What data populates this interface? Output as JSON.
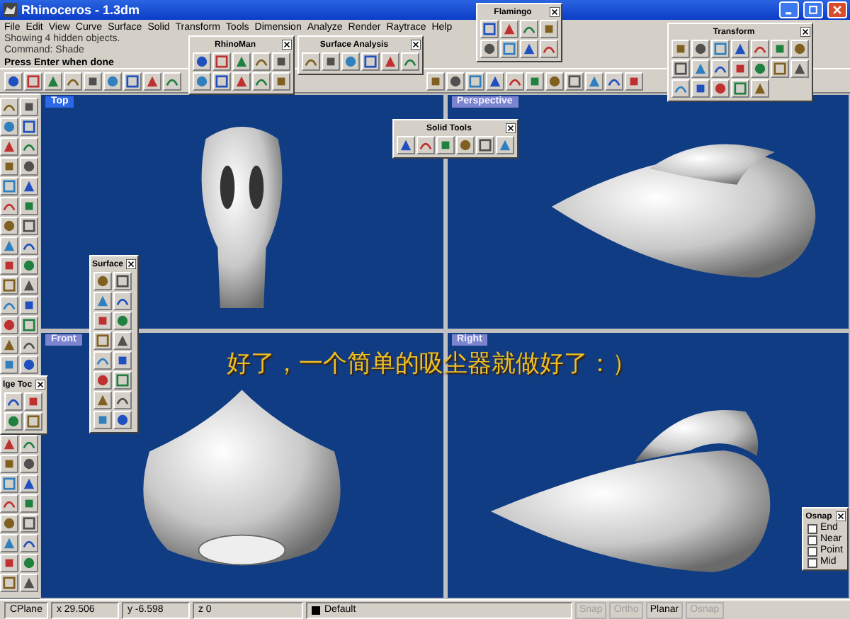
{
  "window": {
    "title": "Rhinoceros - 1.3dm"
  },
  "menu": [
    "File",
    "Edit",
    "View",
    "Curve",
    "Surface",
    "Solid",
    "Transform",
    "Tools",
    "Dimension",
    "Analyze",
    "Render",
    "Raytrace",
    "Help"
  ],
  "command": {
    "history": [
      "Showing 4 hidden objects.",
      "Command: Shade"
    ],
    "prompt": "Press Enter when done"
  },
  "viewports": [
    {
      "label": "Top",
      "active": true
    },
    {
      "label": "Perspective",
      "active": false
    },
    {
      "label": "Front",
      "active": false
    },
    {
      "label": "Right",
      "active": false
    }
  ],
  "caption": "好了，一个简单的吸尘器就做好了：）",
  "floating_toolbars": [
    {
      "title": "RhinoMan",
      "kind": "buttons"
    },
    {
      "title": "Surface Analysis",
      "kind": "buttons"
    },
    {
      "title": "Flamingo",
      "kind": "buttons"
    },
    {
      "title": "Transform",
      "kind": "buttons"
    },
    {
      "title": "Solid Tools",
      "kind": "buttons"
    },
    {
      "title": "Surface",
      "kind": "buttons"
    },
    {
      "title": "lge Toc",
      "kind": "buttons"
    },
    {
      "title": "Osnap",
      "kind": "checklist",
      "items": [
        {
          "label": "End",
          "checked": false
        },
        {
          "label": "Near",
          "checked": false
        },
        {
          "label": "Point",
          "checked": false
        },
        {
          "label": "Mid",
          "checked": false
        }
      ]
    }
  ],
  "status_bar": {
    "cplane": "CPlane",
    "x": "x 29.506",
    "y": "y -6.598",
    "z": "z 0",
    "layer": "Default",
    "toggles": [
      {
        "label": "Snap",
        "on": false
      },
      {
        "label": "Ortho",
        "on": false
      },
      {
        "label": "Planar",
        "on": true
      },
      {
        "label": "Osnap",
        "on": false
      }
    ]
  }
}
